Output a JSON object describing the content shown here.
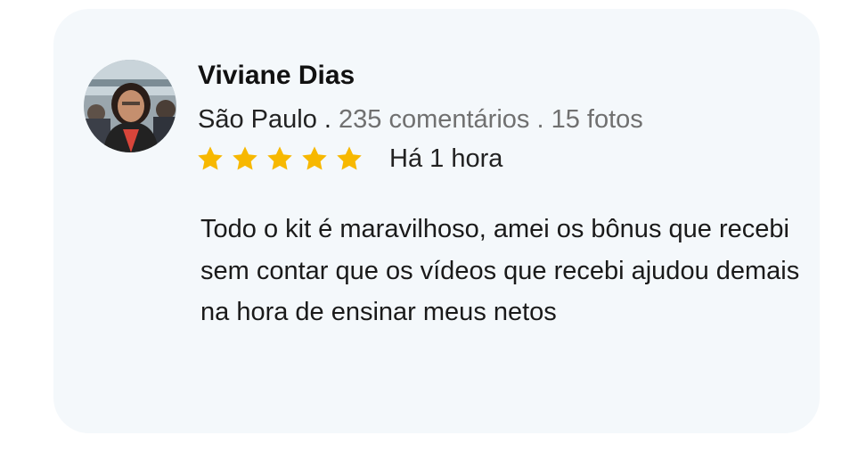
{
  "review": {
    "name": "Viviane Dias",
    "city": "São Paulo .",
    "comments": "235 comentários .",
    "photos": "15 fotos",
    "rating": 5,
    "rating_max": 5,
    "time": "Há 1 hora",
    "text": "Todo o kit é maravilhoso, amei os bônus que recebi sem contar que os vídeos que recebi ajudou demais na hora de ensinar meus netos"
  },
  "colors": {
    "card_background": "#f4f8fb",
    "star": "#f7b800",
    "secondary_text": "#707070"
  },
  "icons": {
    "avatar": "user-photo",
    "star": "star-icon"
  }
}
